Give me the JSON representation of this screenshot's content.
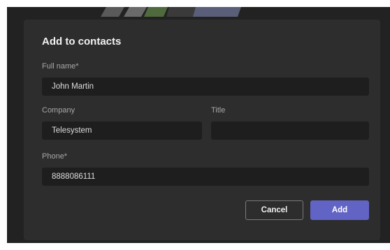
{
  "dialog": {
    "title": "Add to contacts",
    "fields": {
      "full_name": {
        "label": "Full name*",
        "value": "John Martin"
      },
      "company": {
        "label": "Company",
        "value": "Telesystem"
      },
      "title": {
        "label": "Title",
        "value": ""
      },
      "phone": {
        "label": "Phone*",
        "value": "8888086111"
      }
    },
    "buttons": {
      "cancel": "Cancel",
      "add": "Add"
    }
  },
  "colors": {
    "accent": "#6264c5",
    "dialog_background": "#2d2d2d",
    "field_background": "#1e1e1e"
  }
}
